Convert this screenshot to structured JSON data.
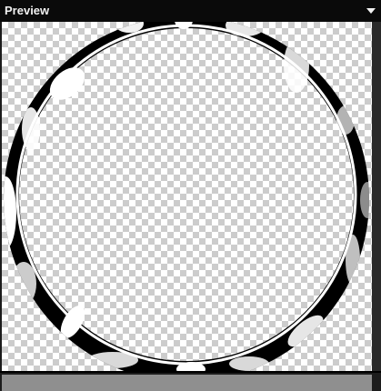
{
  "window": {
    "title": "Preview"
  },
  "icons": {
    "menu": "chevron-down-icon"
  },
  "colors": {
    "titlebar": "#0a0a0a",
    "checker_light": "#ffffff",
    "checker_dark": "#cccccc",
    "ring_dark": "#000000",
    "ring_light": "#ffffff",
    "statusbar": "#8f8f8f"
  }
}
